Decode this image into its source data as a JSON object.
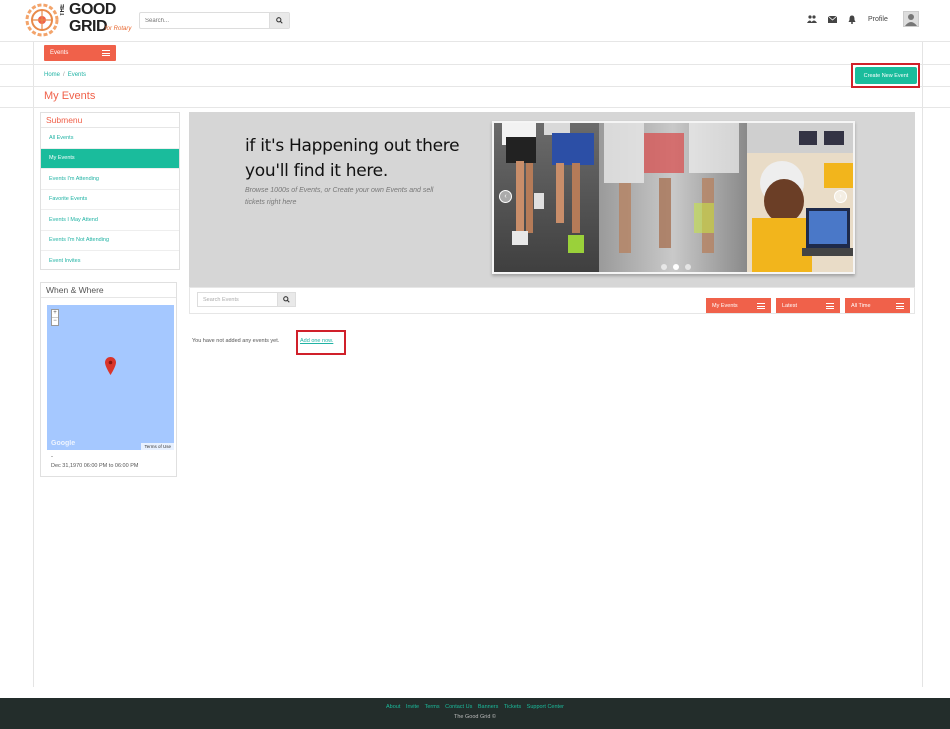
{
  "header": {
    "logo_top": "THE",
    "logo_good": "GOOD",
    "logo_grid": "GRID",
    "logo_tagline": "for Rotary",
    "search_placeholder": "Search...",
    "profile_label": "Profile"
  },
  "nav": {
    "events_label": "Events"
  },
  "breadcrumb": {
    "home": "Home",
    "separator": "/",
    "current": "Events"
  },
  "create_button": "Create New Event",
  "page_title": "My Events",
  "submenu": {
    "title": "Submenu",
    "items": [
      {
        "label": "All Events",
        "active": false
      },
      {
        "label": "My Events",
        "active": true
      },
      {
        "label": "Events I'm Attending",
        "active": false
      },
      {
        "label": "Favorite Events",
        "active": false
      },
      {
        "label": "Events I May Attend",
        "active": false
      },
      {
        "label": "Events I'm Not Attending",
        "active": false
      },
      {
        "label": "Event Invites",
        "active": false
      }
    ]
  },
  "when_where": {
    "title": "When & Where",
    "zoom_in": "+",
    "zoom_out": "−",
    "map_brand": "Google",
    "terms": "Terms of Use",
    "location": "-",
    "date": "Dec 31,1970 06:00 PM to 06:00 PM"
  },
  "banner": {
    "line1": "if it's Happening out there",
    "line2": "you'll find it here.",
    "sub": "Browse 1000s of Events, or Create your own Events and sell tickets right here",
    "prev_arrow": "‹",
    "next_arrow": "›"
  },
  "toolbar": {
    "search_placeholder": "Search Events",
    "filter_scope": "My Events",
    "filter_sort": "Latest",
    "filter_time": "All Time"
  },
  "empty_state": {
    "message": "You have not added any events yet.",
    "link": "Add one now."
  },
  "footer": {
    "links": [
      "About",
      "Invite",
      "Terms",
      "Contact Us",
      "Banners",
      "Tickets",
      "Support Center"
    ],
    "copyright": "The Good Grid ©"
  },
  "colors": {
    "accent_red": "#f0614a",
    "accent_teal": "#1abc9c",
    "highlight_box": "#d0202a",
    "footer_bg": "#232d2b"
  }
}
